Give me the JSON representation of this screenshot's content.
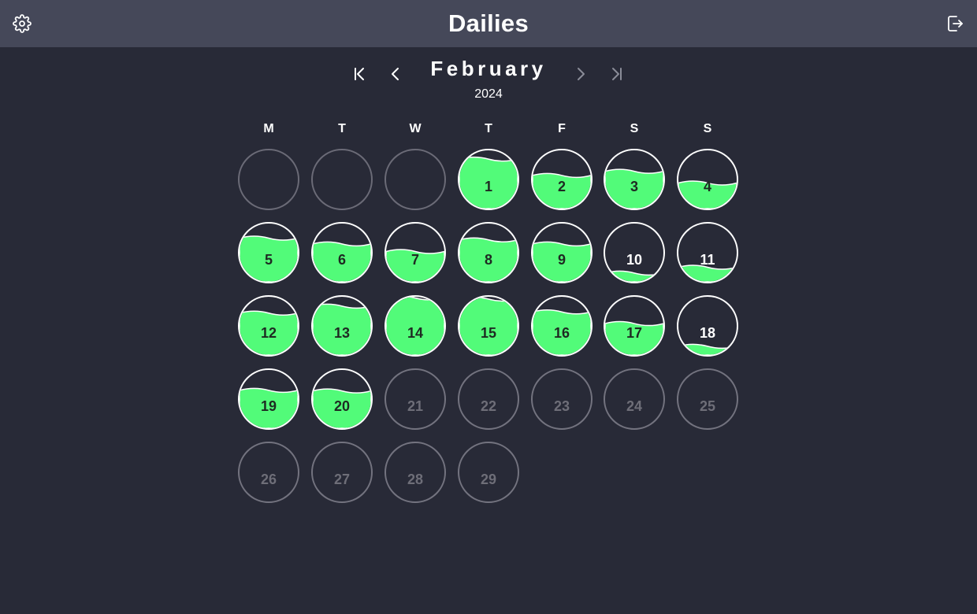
{
  "app": {
    "title": "Dailies"
  },
  "header": {
    "settings_icon": "gear-icon",
    "logout_icon": "logout-icon"
  },
  "nav": {
    "month": "February",
    "year": "2024",
    "icons": {
      "first": "skip-to-first-icon",
      "prev": "chevron-left-icon",
      "next": "chevron-right-icon",
      "last": "skip-to-last-icon"
    }
  },
  "colors": {
    "background": "#282a37",
    "header": "#454859",
    "fill": "#52fb79",
    "text": "#ffffff",
    "future_text": "#6e6e78"
  },
  "weekdays": [
    "M",
    "T",
    "W",
    "T",
    "F",
    "S",
    "S"
  ],
  "leading_blank_days": 3,
  "days": [
    {
      "label": "1",
      "fill": 0.85,
      "state": "filled"
    },
    {
      "label": "2",
      "fill": 0.57,
      "state": "filled"
    },
    {
      "label": "3",
      "fill": 0.64,
      "state": "filled"
    },
    {
      "label": "4",
      "fill": 0.44,
      "state": "filled"
    },
    {
      "label": "5",
      "fill": 0.75,
      "state": "filled"
    },
    {
      "label": "6",
      "fill": 0.65,
      "state": "filled"
    },
    {
      "label": "7",
      "fill": 0.52,
      "state": "filled"
    },
    {
      "label": "8",
      "fill": 0.72,
      "state": "filled"
    },
    {
      "label": "9",
      "fill": 0.65,
      "state": "filled"
    },
    {
      "label": "10",
      "fill": 0.15,
      "state": "filled"
    },
    {
      "label": "11",
      "fill": 0.25,
      "state": "filled"
    },
    {
      "label": "12",
      "fill": 0.72,
      "state": "filled"
    },
    {
      "label": "13",
      "fill": 0.84,
      "state": "filled"
    },
    {
      "label": "14",
      "fill": 0.98,
      "state": "filled"
    },
    {
      "label": "15",
      "fill": 0.96,
      "state": "filled"
    },
    {
      "label": "16",
      "fill": 0.74,
      "state": "filled"
    },
    {
      "label": "17",
      "fill": 0.54,
      "state": "filled"
    },
    {
      "label": "18",
      "fill": 0.15,
      "state": "filled"
    },
    {
      "label": "19",
      "fill": 0.65,
      "state": "filled"
    },
    {
      "label": "20",
      "fill": 0.64,
      "state": "filled"
    },
    {
      "label": "21",
      "fill": 0,
      "state": "future"
    },
    {
      "label": "22",
      "fill": 0,
      "state": "future"
    },
    {
      "label": "23",
      "fill": 0,
      "state": "future"
    },
    {
      "label": "24",
      "fill": 0,
      "state": "future"
    },
    {
      "label": "25",
      "fill": 0,
      "state": "future"
    },
    {
      "label": "26",
      "fill": 0,
      "state": "future"
    },
    {
      "label": "27",
      "fill": 0,
      "state": "future"
    },
    {
      "label": "28",
      "fill": 0,
      "state": "future"
    },
    {
      "label": "29",
      "fill": 0,
      "state": "future"
    }
  ]
}
